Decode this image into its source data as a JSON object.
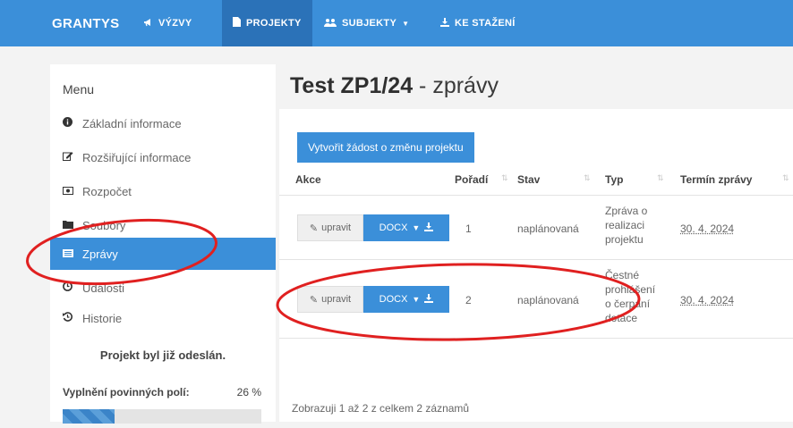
{
  "nav": {
    "brand": "GRANTYS",
    "items": [
      {
        "label": "VÝZVY",
        "icon": "megaphone-icon"
      },
      {
        "label": "PROJEKTY",
        "icon": "file-icon"
      },
      {
        "label": "SUBJEKTY",
        "icon": "users-icon"
      },
      {
        "label": "KE STAŽENÍ",
        "icon": "download-icon"
      }
    ]
  },
  "sidebar": {
    "title": "Menu",
    "items": [
      {
        "label": "Základní informace",
        "icon": "info-icon"
      },
      {
        "label": "Rozšiřující informace",
        "icon": "edit-icon"
      },
      {
        "label": "Rozpočet",
        "icon": "money-icon"
      },
      {
        "label": "Soubory",
        "icon": "folder-icon"
      },
      {
        "label": "Zprávy",
        "icon": "list-icon"
      },
      {
        "label": "Události",
        "icon": "clock-icon"
      },
      {
        "label": "Historie",
        "icon": "history-icon"
      }
    ],
    "sent_notice": "Projekt byl již odeslán.",
    "required_label": "Vyplnění povinných polí:",
    "required_pct": "26 %",
    "required_value": 26
  },
  "main": {
    "title_bold": "Test ZP1/24",
    "title_rest": " - zprávy",
    "create_button": "Vytvořit žádost o změnu projektu",
    "headers": [
      "Akce",
      "Pořadí",
      "Stav",
      "Typ",
      "Termín zprávy"
    ],
    "edit_label": "upravit",
    "docx_label": "DOCX",
    "rows": [
      {
        "order": "1",
        "status": "naplánovaná",
        "type_lines": [
          "Zpráva o",
          "realizaci",
          "projektu"
        ],
        "date": "30. 4. 2024"
      },
      {
        "order": "2",
        "status": "naplánovaná",
        "type_lines": [
          "Čestné",
          "prohlášení",
          "o čerpání",
          "dotace"
        ],
        "date": "30. 4. 2024"
      }
    ],
    "footer": "Zobrazuji 1 až 2 z celkem 2 záznamů"
  },
  "colors": {
    "accent": "#3b8fd9",
    "accent_dark": "#2b72b8",
    "annotation": "#e02020"
  }
}
